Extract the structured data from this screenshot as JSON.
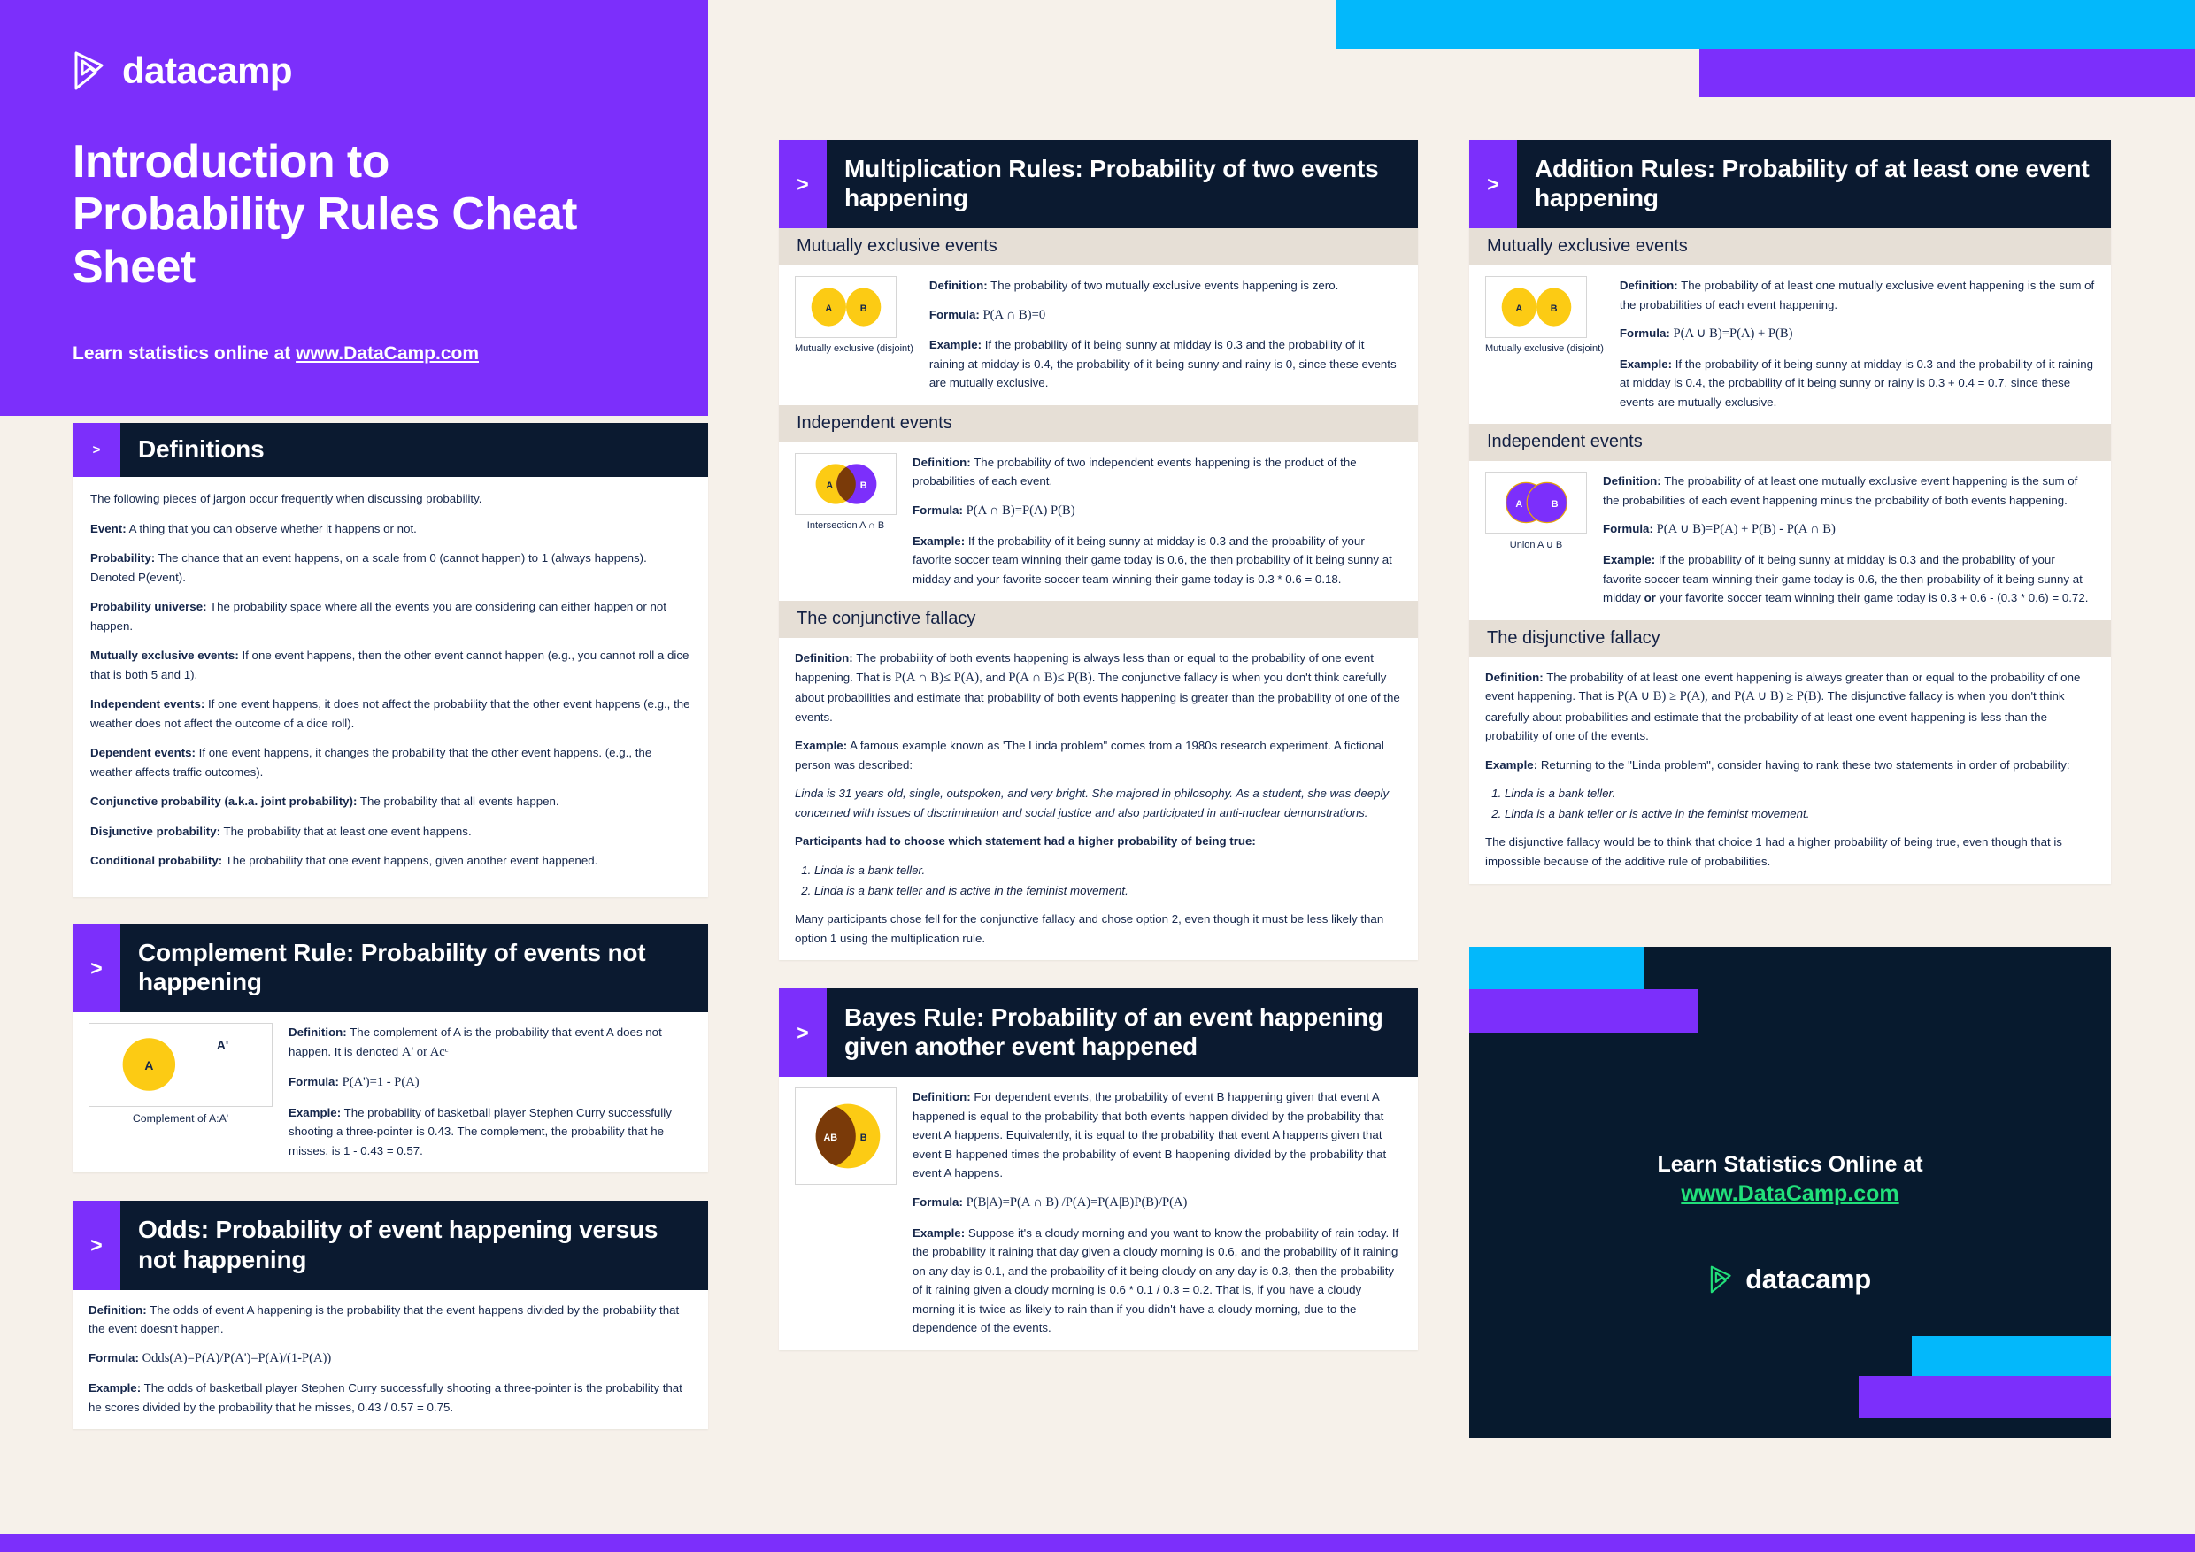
{
  "colors": {
    "brand_purple": "#7c2ffb",
    "brand_cyan": "#03b8fb",
    "brand_navy": "#0b1a30",
    "page_bg": "#f6f1ea",
    "subhead_bg": "#e6dfd6",
    "accent_green": "#21e07a",
    "venn_yellow": "#fccb14",
    "venn_purple": "#7c2ffb",
    "venn_overlap": "#7a3a09"
  },
  "hero": {
    "logo_text": "datacamp",
    "logo_icon": "datacamp-logo-icon",
    "title": "Introduction to Probability Rules Cheat Sheet",
    "subtitle_prefix": "Learn statistics online at ",
    "subtitle_link": "www.DataCamp.com"
  },
  "definitions": {
    "chevron": ">",
    "title": "Definitions",
    "intro": "The following pieces of jargon occur frequently when discussing probability.",
    "items": [
      {
        "term": "Event:",
        "text": " A thing that you can observe whether it happens or not."
      },
      {
        "term": "Probability:",
        "text": " The chance that an event happens, on a scale from 0 (cannot happen) to 1 (always happens). Denoted P(event)."
      },
      {
        "term": "Probability universe:",
        "text": " The probability space where all the events you are considering can either happen or not happen."
      },
      {
        "term": "Mutually exclusive events:",
        "text": " If one event happens, then the other event cannot happen (e.g., you cannot roll a dice that is both 5 and 1)."
      },
      {
        "term": "Independent events:",
        "text": " If one event happens, it does not affect the probability that the other event happens (e.g., the weather does not affect the outcome of a dice roll)."
      },
      {
        "term": "Dependent events:",
        "text": " If one event happens, it changes the probability that the other event happens. (e.g., the weather affects traffic outcomes)."
      },
      {
        "term": "Conjunctive probability (a.k.a. joint probability):",
        "text": " The probability that all events happen."
      },
      {
        "term": "Disjunctive probability:",
        "text": " The probability that at least one event happens."
      },
      {
        "term": "Conditional probability:",
        "text": " The probability that one event happens, given another event happened."
      }
    ]
  },
  "complement_rule": {
    "chevron": ">",
    "title": "Complement Rule: Probability of events not happening",
    "diagram_caption": "Complement of  A:A'",
    "diagram_labels": {
      "inner": "A",
      "outer": "A'"
    },
    "definition_label": "Definition:",
    "definition_text": " The complement of A is the probability that event A does not happen. It is denoted ",
    "definition_formula": "A' or Acᶜ",
    "formula_label": "Formula:",
    "formula": "P(A')=1 - P(A)",
    "example_label": "Example:",
    "example_text": " The probability of basketball player Stephen Curry successfully shooting a three-pointer is 0.43. The complement, the probability that he misses, is 1 - 0.43 = 0.57."
  },
  "odds": {
    "chevron": ">",
    "title": "Odds: Probability of event happening versus not happening",
    "definition_label": "Definition:",
    "definition_text": " The odds of event A happening is the probability that the event happens divided by the probability that the event doesn't happen.",
    "formula_label": "Formula:",
    "formula": "Odds(A)=P(A)/P(A')=P(A)/(1-P(A))",
    "example_label": "Example:",
    "example_text": " The odds of basketball player Stephen Curry successfully shooting a three-pointer is the probability that he scores divided by the probability that he misses, 0.43 / 0.57 = 0.75."
  },
  "multiplication_rules": {
    "chevron": ">",
    "title": "Multiplication Rules: Probability of two events happening",
    "mutually_exclusive": {
      "subhead": "Mutually exclusive events",
      "diagram_caption": "Mutually exclusive (disjoint)",
      "diagram_labels": {
        "a": "A",
        "b": "B"
      },
      "definition_label": "Definition:",
      "definition_text": " The probability of two mutually exclusive events happening is zero.",
      "formula_label": "Formula:",
      "formula": "P(A ∩ B)=0",
      "example_label": "Example:",
      "example_text": " If the probability of it being sunny at midday is 0.3 and the probability of it raining at midday is 0.4, the probability of it being sunny and rainy is 0, since these events are mutually exclusive."
    },
    "independent": {
      "subhead": "Independent events",
      "diagram_caption": "Intersection A ∩ B",
      "diagram_labels": {
        "a": "A",
        "b": "B"
      },
      "definition_label": "Definition:",
      "definition_text": " The probability of two independent events happening is the product of the probabilities of each event.",
      "formula_label": "Formula:",
      "formula": "P(A ∩ B)=P(A) P(B)",
      "example_label": "Example:",
      "example_text": " If the probability of it being sunny at midday is 0.3 and the probability of your favorite soccer team winning their game today is 0.6, the then probability of it being sunny at midday and your favorite soccer team winning their game today is 0.3 * 0.6 = 0.18."
    },
    "conjunctive_fallacy": {
      "subhead": "The conjunctive fallacy",
      "definition_label": "Definition:",
      "definition_text_1": " The probability of both events happening is always less than or equal to the probability of one event happening. That is ",
      "definition_formula_1": "P(A ∩ B)≤ P(A)",
      "definition_text_2": ", and ",
      "definition_formula_2": "P(A ∩ B)≤ P(B)",
      "definition_text_3": ". The conjunctive fallacy is when you don't think carefully about probabilities and estimate that probability of both events happening is greater than the probability of one of the events.",
      "example_label": "Example:",
      "example_text": " A famous example known as 'The Linda problem\" comes from a 1980s research experiment. A fictional person was described:",
      "linda_description": "Linda is 31 years old, single, outspoken, and very bright. She majored in philosophy. As a student, she was deeply concerned with issues of discrimination and social justice and also participated in anti-nuclear demonstrations.",
      "prompt": "Participants had to choose which statement had a higher probability of being true:",
      "options": [
        "Linda is a bank teller.",
        "Linda is a bank teller and is active in the feminist movement."
      ],
      "conclusion": "Many participants chose fell for the conjunctive fallacy and chose option 2, even though it must be less likely than option 1 using the multiplication rule."
    }
  },
  "bayes_rule": {
    "chevron": ">",
    "title": "Bayes Rule: Probability of an event happening given another event happened",
    "diagram_labels": {
      "ab": "AB",
      "b": "B"
    },
    "definition_label": "Definition:",
    "definition_text": " For dependent events, the probability of event B happening given that event A happened is equal to the probability that both events happen divided by the probability that event A happens. Equivalently, it is equal to the probability that event A happens given that event B happened times the probability of event B happening divided by the probability that event A happens.",
    "formula_label": "Formula:",
    "formula": "P(B|A)=P(A ∩ B) /P(A)=P(A|B)P(B)/P(A)",
    "example_label": "Example:",
    "example_text": " Suppose it's a cloudy morning and you want to know the probability of rain today. If the probability it raining that day given a cloudy morning is 0.6, and the probability of it raining on any day is 0.1, and the probability of it being cloudy on any day is 0.3, then the probability of it raining given a cloudy morning is 0.6 * 0.1 / 0.3 = 0.2. That is, if you have a cloudy morning it is twice as likely to rain than if you didn't have a cloudy morning, due to the dependence of the events."
  },
  "addition_rules": {
    "chevron": ">",
    "title": "Addition Rules: Probability of at least one event happening",
    "mutually_exclusive": {
      "subhead": "Mutually exclusive events",
      "diagram_caption": "Mutually exclusive (disjoint)",
      "diagram_labels": {
        "a": "A",
        "b": "B"
      },
      "definition_label": "Definition:",
      "definition_text": " The probability of at least one mutually exclusive event happening is the sum of the probabilities of each event happening.",
      "formula_label": "Formula:",
      "formula": "P(A ∪ B)=P(A) + P(B)",
      "example_label": "Example:",
      "example_text": " If the probability of it being sunny at midday is 0.3 and the probability of it raining at midday is 0.4, the probability of it being sunny or rainy is 0.3 + 0.4 = 0.7, since these events are mutually exclusive."
    },
    "independent": {
      "subhead": "Independent events",
      "diagram_caption": "Union A ∪ B",
      "diagram_labels": {
        "a": "A",
        "b": "B"
      },
      "definition_label": "Definition:",
      "definition_text": " The probability of at least one mutually exclusive event happening is the sum of the probabilities of each event happening minus the probability of both events happening.",
      "formula_label": "Formula:",
      "formula": "P(A ∪ B)=P(A) + P(B) - P(A ∩ B)",
      "example_label": "Example:",
      "example_text_1": " If the probability of it being sunny at midday is 0.3 and the probability of your favorite soccer team winning their game today is 0.6, the then probability of it being sunny at midday ",
      "example_bold": "or",
      "example_text_2": " your favorite soccer team winning their game today is 0.3 + 0.6 - (0.3 * 0.6) = 0.72."
    },
    "disjunctive_fallacy": {
      "subhead": "The disjunctive fallacy",
      "definition_label": "Definition:",
      "definition_text_1": " The probability of at least one event happening is always greater than or equal to the probability of one event happening. That is ",
      "definition_formula_1": "P(A ∪ B) ≥ P(A),",
      "definition_text_2": "  and ",
      "definition_formula_2": " P(A ∪ B) ≥ P(B)",
      "definition_text_3": ". The disjunctive fallacy is when you don't think carefully about probabilities and estimate that the probability of at least one event happening is less than the probability of one of the events.",
      "example_label": "Example:",
      "example_text": " Returning to the \"Linda problem\", consider having to rank these two statements in order of probability:",
      "options": [
        "Linda is a bank teller.",
        "Linda is a bank teller or is active in the feminist movement."
      ],
      "conclusion": "The disjunctive fallacy would be to think that choice 1 had a higher probability of being true, even though that is impossible because of the additive rule of probabilities."
    }
  },
  "promo": {
    "line1": "Learn Statistics Online at",
    "link": "www.DataCamp.com",
    "logo_text": "datacamp",
    "logo_icon": "datacamp-logo-icon"
  }
}
